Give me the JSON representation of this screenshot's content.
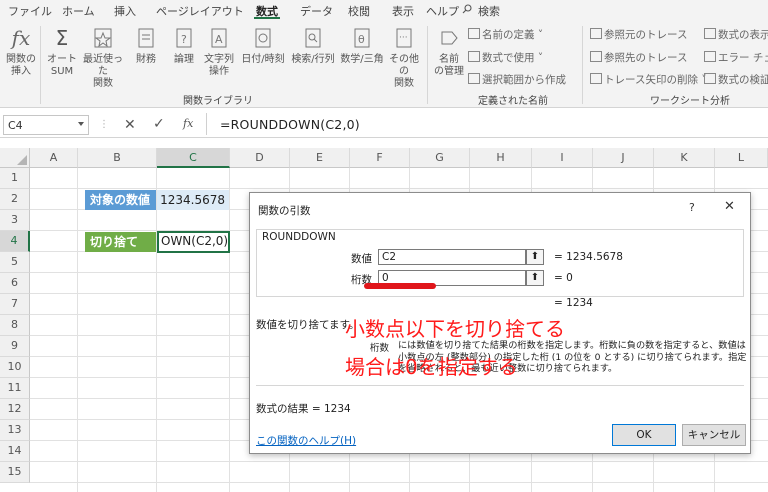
{
  "ribbon_tabs": [
    "ファイル",
    "ホーム",
    "挿入",
    "ページレイアウト",
    "数式",
    "データ",
    "校閲",
    "表示",
    "ヘルプ"
  ],
  "active_tab": "数式",
  "search_label": "検索",
  "ribbon": {
    "insert_function": "関数の\n挿入",
    "autosum": "オート\nSUM",
    "recent": "最近使った\n関数",
    "financial": "財務",
    "logical": "論理",
    "text": "文字列\n操作",
    "datetime": "日付/時刻",
    "lookup": "検索/行列",
    "math": "数学/三角",
    "more": "その他の\n関数",
    "library_group": "関数ライブラリ",
    "name_manager": "名前\nの管理",
    "define_name": "名前の定義",
    "use_in_formula": "数式で使用",
    "create_from_selection": "選択範囲から作成",
    "defined_names_group": "定義された名前",
    "trace_precedents": "参照元のトレース",
    "trace_dependents": "参照先のトレース",
    "remove_arrows": "トレース矢印の削除",
    "show_formulas": "数式の表示",
    "error_check": "エラー チェック",
    "evaluate_formula": "数式の検証",
    "auditing_group": "ワークシート分析"
  },
  "formula_bar": {
    "name_box": "C4",
    "formula": "=ROUNDDOWN(C2,0)"
  },
  "columns": [
    "A",
    "B",
    "C",
    "D",
    "E",
    "F",
    "G",
    "H",
    "I",
    "J",
    "K",
    "L"
  ],
  "rows": [
    "1",
    "2",
    "3",
    "4",
    "5",
    "6",
    "7",
    "8",
    "9",
    "10",
    "11",
    "12",
    "13",
    "14",
    "15"
  ],
  "cells": {
    "b2": "対象の数値",
    "c2": "1234.5678",
    "b4": "切り捨て",
    "c4": "OWN(C2,0)"
  },
  "dialog": {
    "title": "関数の引数",
    "help": "?",
    "close": "✕",
    "function_name": "ROUNDDOWN",
    "arg1_label": "数値",
    "arg1_value": "C2",
    "arg1_result": "= 1234.5678",
    "arg2_label": "桁数",
    "arg2_value": "0",
    "arg2_result": "= 0",
    "result": "= 1234",
    "description": "数値を切り捨てます。",
    "arg_desc_name": "桁数",
    "arg_desc": "には数値を切り捨てた結果の桁数を指定します。桁数に負の数を指定すると、数値は小数点の左 (整数部分) の指定した桁 (1 の位を 0 とする) に切り捨てられます。指定を省略されると、最も近い整数に切り捨てられます。",
    "formula_result": "数式の結果 =   1234",
    "help_link": "この関数のヘルプ(H)",
    "ok": "OK",
    "cancel": "キャンセル"
  },
  "annotation": {
    "line1": "小数点以下を切り捨てる",
    "line2": "場合は0を指定する",
    "color": "#ff1a1a"
  },
  "colors": {
    "header_blue": "#5b9bd5",
    "header_green": "#70ad47",
    "value_fill": "#ddebf7",
    "excel_green": "#217346"
  }
}
